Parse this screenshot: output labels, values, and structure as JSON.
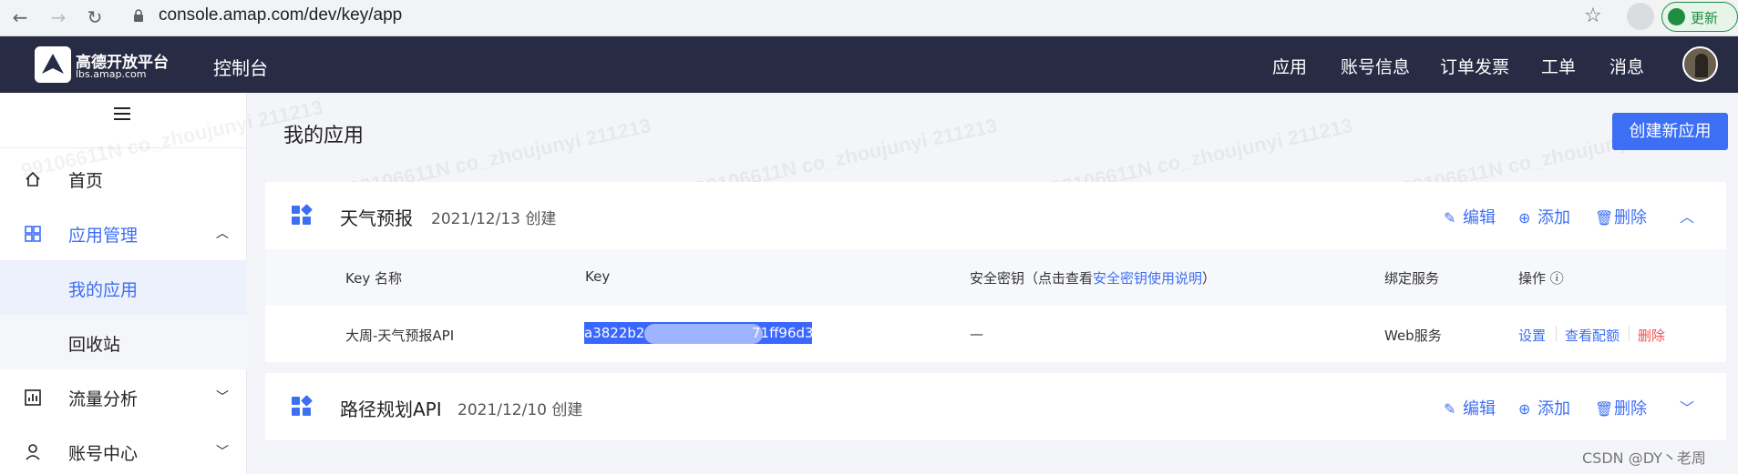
{
  "browser": {
    "url": "console.amap.com/dev/key/app",
    "update_label": "更新"
  },
  "header": {
    "logo_name": "高德开放平台",
    "logo_domain": "lbs.amap.com",
    "console_title": "控制台",
    "nav": [
      "应用",
      "账号信息",
      "订单发票",
      "工单",
      "消息"
    ]
  },
  "sidebar": {
    "items": [
      {
        "label": "首页"
      },
      {
        "label": "应用管理"
      },
      {
        "label": "我的应用"
      },
      {
        "label": "回收站"
      },
      {
        "label": "流量分析"
      },
      {
        "label": "账号中心"
      }
    ]
  },
  "main": {
    "page_title": "我的应用",
    "create_button": "创建新应用",
    "watermark": "99106611N co_zhoujunyi 211213",
    "apps": [
      {
        "name": "天气预报",
        "created": "2021/12/13 创建",
        "actions": {
          "edit": "编辑",
          "add": "添加",
          "delete": "删除"
        },
        "table": {
          "headers": {
            "key_name": "Key 名称",
            "key": "Key",
            "secret_prefix": "安全密钥（点击查看",
            "secret_link": "安全密钥使用说明",
            "secret_suffix": "）",
            "service": "绑定服务",
            "ops": "操作"
          },
          "rows": [
            {
              "key_name": "大周-天气预报API",
              "key_start": "a3822b28",
              "key_end": "71ff96d3",
              "secret": "—",
              "service": "Web服务",
              "ops": {
                "settings": "设置",
                "quota": "查看配额",
                "delete": "删除"
              }
            }
          ]
        }
      },
      {
        "name": "路径规划API",
        "created": "2021/12/10 创建",
        "actions": {
          "edit": "编辑",
          "add": "添加",
          "delete": "删除"
        }
      }
    ]
  },
  "credit": "CSDN @DY丶老周",
  "colors": {
    "accent": "#3d6ff5",
    "header_bg": "#272b44",
    "danger": "#f05050"
  }
}
